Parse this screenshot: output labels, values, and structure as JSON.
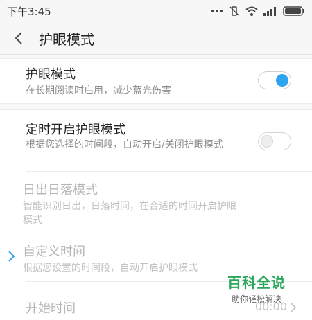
{
  "statusbar": {
    "time": "下午3:45",
    "icons": [
      "more-dots-icon",
      "vibrate-off-icon",
      "wifi-icon",
      "signal-icon",
      "battery-icon"
    ]
  },
  "appbar": {
    "title": "护眼模式",
    "back_icon": "back-chevron-icon"
  },
  "eye_mode": {
    "title": "护眼模式",
    "desc": "在长期阅读时启用，减少蓝光伤害",
    "enabled": true
  },
  "schedule": {
    "title": "定时开启护眼模式",
    "desc": "根据您选择的时间段，自动开启/关闭护眼模式",
    "enabled": false
  },
  "sunset": {
    "title": "日出日落模式",
    "desc": "智能识别日出，日落时间，在合适的时间开启护眼模式"
  },
  "custom": {
    "title": "自定义时间",
    "desc": "根据您设置的时间段，自动开启护眼模式"
  },
  "start_time": {
    "title": "开始时间",
    "value": "00:00"
  },
  "colors": {
    "accent": "#2ea3f2",
    "brand": "#2aa85a"
  },
  "watermark": {
    "brand": "百科全说",
    "sub": "助你轻松解决"
  }
}
